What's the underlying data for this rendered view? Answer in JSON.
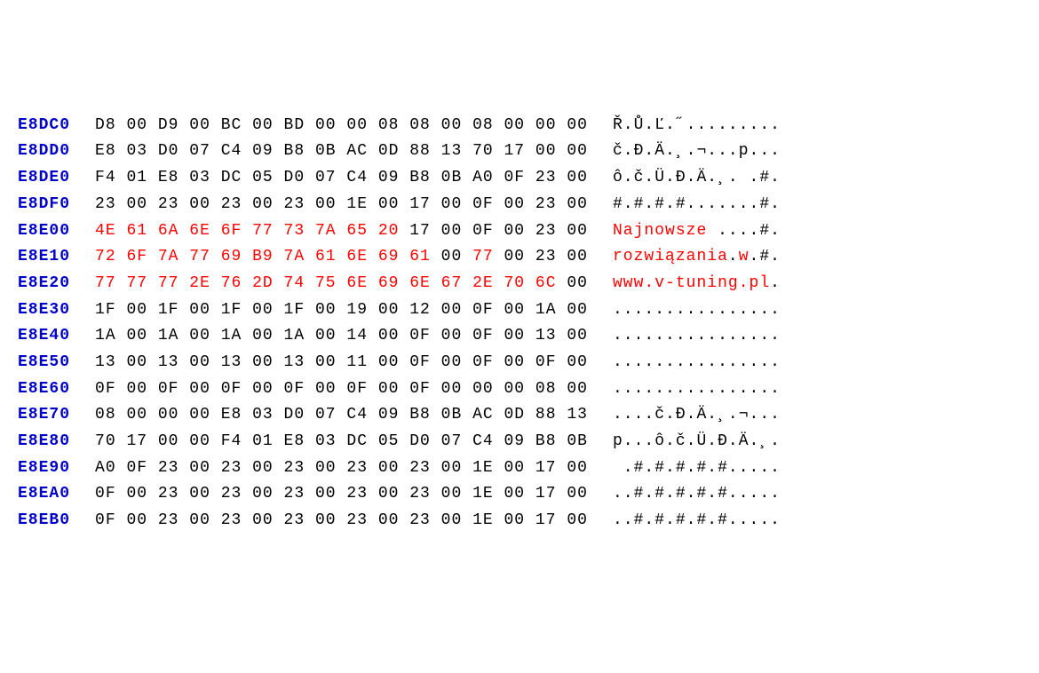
{
  "rows": [
    {
      "offset": "E8DC0",
      "bytes": [
        "D8",
        "00",
        "D9",
        "00",
        "BC",
        "00",
        "BD",
        "00",
        "00",
        "08",
        "08",
        "00",
        "08",
        "00",
        "00",
        "00"
      ],
      "redBytes": [],
      "ascii": "Ř.Ů.Ľ.˝.........",
      "asciiRed": []
    },
    {
      "offset": "E8DD0",
      "bytes": [
        "E8",
        "03",
        "D0",
        "07",
        "C4",
        "09",
        "B8",
        "0B",
        "AC",
        "0D",
        "88",
        "13",
        "70",
        "17",
        "00",
        "00"
      ],
      "redBytes": [],
      "ascii": "č.Đ.Ä.¸.¬...p...",
      "asciiRed": []
    },
    {
      "offset": "E8DE0",
      "bytes": [
        "F4",
        "01",
        "E8",
        "03",
        "DC",
        "05",
        "D0",
        "07",
        "C4",
        "09",
        "B8",
        "0B",
        "A0",
        "0F",
        "23",
        "00"
      ],
      "redBytes": [],
      "ascii": "ô.č.Ü.Đ.Ä.¸. .#.",
      "asciiRed": []
    },
    {
      "offset": "E8DF0",
      "bytes": [
        "23",
        "00",
        "23",
        "00",
        "23",
        "00",
        "23",
        "00",
        "1E",
        "00",
        "17",
        "00",
        "0F",
        "00",
        "23",
        "00"
      ],
      "redBytes": [],
      "ascii": "#.#.#.#.......#.",
      "asciiRed": []
    },
    {
      "offset": "E8E00",
      "bytes": [
        "4E",
        "61",
        "6A",
        "6E",
        "6F",
        "77",
        "73",
        "7A",
        "65",
        "20",
        "17",
        "00",
        "0F",
        "00",
        "23",
        "00"
      ],
      "redBytes": [
        0,
        1,
        2,
        3,
        4,
        5,
        6,
        7,
        8,
        9
      ],
      "ascii": "Najnowsze ....#.",
      "asciiRed": [
        0,
        1,
        2,
        3,
        4,
        5,
        6,
        7,
        8,
        9
      ]
    },
    {
      "offset": "E8E10",
      "bytes": [
        "72",
        "6F",
        "7A",
        "77",
        "69",
        "B9",
        "7A",
        "61",
        "6E",
        "69",
        "61",
        "00",
        "77",
        "00",
        "23",
        "00"
      ],
      "redBytes": [
        0,
        1,
        2,
        3,
        4,
        5,
        6,
        7,
        8,
        9,
        10,
        12
      ],
      "ascii": "rozwiązania.w.#.",
      "asciiRed": [
        0,
        1,
        2,
        3,
        4,
        5,
        6,
        7,
        8,
        9,
        10,
        12
      ]
    },
    {
      "offset": "E8E20",
      "bytes": [
        "77",
        "77",
        "77",
        "2E",
        "76",
        "2D",
        "74",
        "75",
        "6E",
        "69",
        "6E",
        "67",
        "2E",
        "70",
        "6C",
        "00"
      ],
      "redBytes": [
        0,
        1,
        2,
        3,
        4,
        5,
        6,
        7,
        8,
        9,
        10,
        11,
        12,
        13,
        14
      ],
      "ascii": "www.v-tuning.pl.",
      "asciiRed": [
        0,
        1,
        2,
        3,
        4,
        5,
        6,
        7,
        8,
        9,
        10,
        11,
        12,
        13,
        14
      ]
    },
    {
      "offset": "E8E30",
      "bytes": [
        "1F",
        "00",
        "1F",
        "00",
        "1F",
        "00",
        "1F",
        "00",
        "19",
        "00",
        "12",
        "00",
        "0F",
        "00",
        "1A",
        "00"
      ],
      "redBytes": [],
      "ascii": "................",
      "asciiRed": []
    },
    {
      "offset": "E8E40",
      "bytes": [
        "1A",
        "00",
        "1A",
        "00",
        "1A",
        "00",
        "1A",
        "00",
        "14",
        "00",
        "0F",
        "00",
        "0F",
        "00",
        "13",
        "00"
      ],
      "redBytes": [],
      "ascii": "................",
      "asciiRed": []
    },
    {
      "offset": "E8E50",
      "bytes": [
        "13",
        "00",
        "13",
        "00",
        "13",
        "00",
        "13",
        "00",
        "11",
        "00",
        "0F",
        "00",
        "0F",
        "00",
        "0F",
        "00"
      ],
      "redBytes": [],
      "ascii": "................",
      "asciiRed": []
    },
    {
      "offset": "E8E60",
      "bytes": [
        "0F",
        "00",
        "0F",
        "00",
        "0F",
        "00",
        "0F",
        "00",
        "0F",
        "00",
        "0F",
        "00",
        "00",
        "00",
        "08",
        "00"
      ],
      "redBytes": [],
      "ascii": "................",
      "asciiRed": []
    },
    {
      "offset": "E8E70",
      "bytes": [
        "08",
        "00",
        "00",
        "00",
        "E8",
        "03",
        "D0",
        "07",
        "C4",
        "09",
        "B8",
        "0B",
        "AC",
        "0D",
        "88",
        "13"
      ],
      "redBytes": [],
      "ascii": "....č.Đ.Ä.¸.¬...",
      "asciiRed": []
    },
    {
      "offset": "E8E80",
      "bytes": [
        "70",
        "17",
        "00",
        "00",
        "F4",
        "01",
        "E8",
        "03",
        "DC",
        "05",
        "D0",
        "07",
        "C4",
        "09",
        "B8",
        "0B"
      ],
      "redBytes": [],
      "ascii": "p...ô.č.Ü.Đ.Ä.¸.",
      "asciiRed": []
    },
    {
      "offset": "E8E90",
      "bytes": [
        "A0",
        "0F",
        "23",
        "00",
        "23",
        "00",
        "23",
        "00",
        "23",
        "00",
        "23",
        "00",
        "1E",
        "00",
        "17",
        "00"
      ],
      "redBytes": [],
      "ascii": " .#.#.#.#.#.....",
      "asciiRed": []
    },
    {
      "offset": "E8EA0",
      "bytes": [
        "0F",
        "00",
        "23",
        "00",
        "23",
        "00",
        "23",
        "00",
        "23",
        "00",
        "23",
        "00",
        "1E",
        "00",
        "17",
        "00"
      ],
      "redBytes": [],
      "ascii": "..#.#.#.#.#.....",
      "asciiRed": []
    },
    {
      "offset": "E8EB0",
      "bytes": [
        "0F",
        "00",
        "23",
        "00",
        "23",
        "00",
        "23",
        "00",
        "23",
        "00",
        "23",
        "00",
        "1E",
        "00",
        "17",
        "00"
      ],
      "redBytes": [],
      "ascii": "..#.#.#.#.#.....",
      "asciiRed": []
    }
  ]
}
